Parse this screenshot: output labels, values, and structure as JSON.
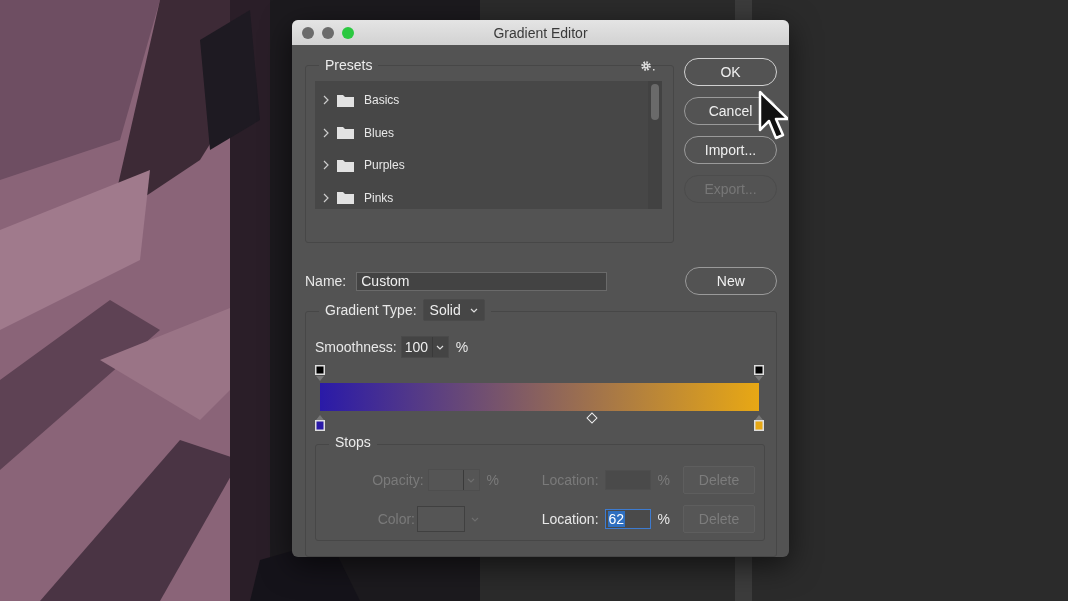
{
  "window": {
    "title": "Gradient Editor",
    "controls": [
      {
        "color": "#6b6b6b"
      },
      {
        "color": "#6b6b6b"
      },
      {
        "color": "#2bc840"
      }
    ]
  },
  "presets": {
    "title": "Presets",
    "items": [
      {
        "label": "Basics",
        "expanded": false
      },
      {
        "label": "Blues",
        "expanded": false
      },
      {
        "label": "Purples",
        "expanded": false
      },
      {
        "label": "Pinks",
        "expanded": false
      }
    ]
  },
  "buttons": [
    {
      "label": "OK",
      "disabled": false,
      "default": true
    },
    {
      "label": "Cancel",
      "disabled": false,
      "default": false
    },
    {
      "label": "Import...",
      "disabled": false,
      "default": false
    },
    {
      "label": "Export...",
      "disabled": true,
      "default": false
    }
  ],
  "name": {
    "label": "Name:",
    "value": "Custom"
  },
  "new_button": {
    "label": "New"
  },
  "gradient_type": {
    "label": "Gradient Type:",
    "value": "Solid"
  },
  "smoothness": {
    "label": "Smoothness:",
    "value": "100",
    "unit": "%"
  },
  "gradient": {
    "opacity_stops": [
      {
        "color": "#000000",
        "level": 0
      },
      {
        "color": "#000000",
        "level": 1
      }
    ],
    "color_stops": [
      {
        "color": "#2a1aa8",
        "level": 0
      },
      {
        "color": "#e8a814",
        "level": 1
      }
    ],
    "midpoint": {
      "level": 0.62
    }
  },
  "stops": {
    "title": "Stops",
    "rows": [
      {
        "kind": "opacity",
        "label": "Opacity:",
        "label_disabled": true,
        "unit": "%",
        "location_label": "Location:",
        "location_disabled": true,
        "location_unit": "%",
        "delete": "Delete",
        "delete_disabled": true
      },
      {
        "kind": "color",
        "label": "Color:",
        "label_disabled": true,
        "location_label": "Location:",
        "location_disabled": false,
        "location_value": "62",
        "location_unit": "%",
        "delete": "Delete",
        "delete_disabled": true
      }
    ]
  }
}
